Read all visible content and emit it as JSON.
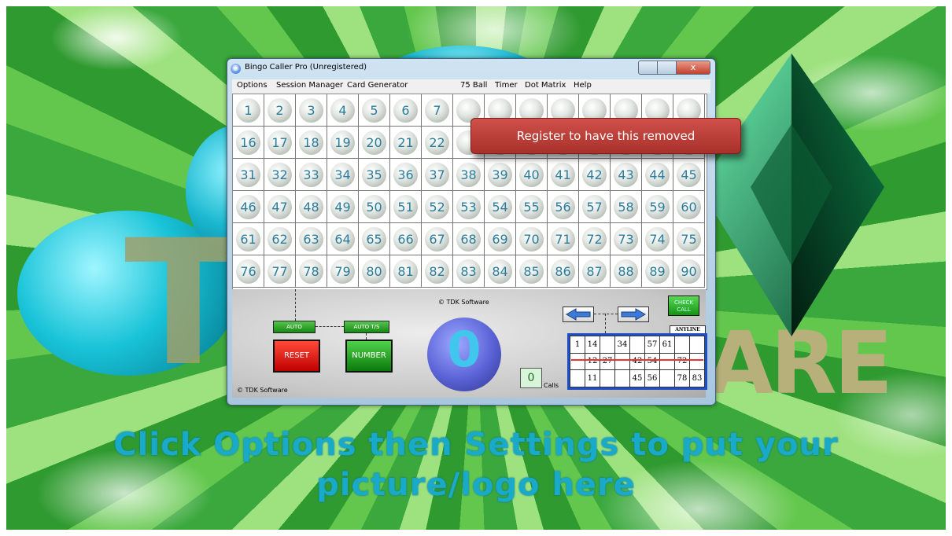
{
  "window": {
    "title": "Bingo Caller Pro (Unregistered)",
    "close_label": "x"
  },
  "menu": [
    "Options",
    "Session Manager",
    "Card Generator",
    "75 Ball",
    "Timer",
    "Dot Matrix",
    "Help"
  ],
  "grid": {
    "rows": [
      [
        "1",
        "2",
        "3",
        "4",
        "5",
        "6",
        "7",
        "",
        "",
        "",
        "",
        "",
        "",
        "",
        ""
      ],
      [
        "16",
        "17",
        "18",
        "19",
        "20",
        "21",
        "22",
        "",
        "",
        "",
        "",
        "",
        "",
        "",
        ""
      ],
      [
        "31",
        "32",
        "33",
        "34",
        "35",
        "36",
        "37",
        "38",
        "39",
        "40",
        "41",
        "42",
        "43",
        "44",
        "45"
      ],
      [
        "46",
        "47",
        "48",
        "49",
        "50",
        "51",
        "52",
        "53",
        "54",
        "55",
        "56",
        "57",
        "58",
        "59",
        "60"
      ],
      [
        "61",
        "62",
        "63",
        "64",
        "65",
        "66",
        "67",
        "68",
        "69",
        "70",
        "71",
        "72",
        "73",
        "74",
        "75"
      ],
      [
        "76",
        "77",
        "78",
        "79",
        "80",
        "81",
        "82",
        "83",
        "84",
        "85",
        "86",
        "87",
        "88",
        "89",
        "90"
      ]
    ]
  },
  "controls": {
    "auto": "AUTO",
    "auto_ts": "AUTO T/S",
    "reset": "RESET",
    "number": "NUMBER",
    "current_number": "0",
    "copyright_top": "© TDK Software",
    "copyright_bottom": "© TDK Software",
    "calls_count": "0",
    "calls_label": "Calls",
    "check_call": "CHECK CALL",
    "anyline": "ANYLINE"
  },
  "card": {
    "rows": [
      [
        "1",
        "14",
        "",
        "34",
        "",
        "57",
        "61",
        "",
        ""
      ],
      [
        "",
        "12",
        "27",
        "",
        "42",
        "54",
        "",
        "72",
        ""
      ],
      [
        "",
        "11",
        "",
        "",
        "45",
        "56",
        "",
        "78",
        "83"
      ]
    ]
  },
  "tooltip": "Register to have this removed",
  "background": {
    "line1": "Click Options then Settings to put your",
    "line2": "picture/logo here",
    "letter_t": "T",
    "letters_are": "ARE"
  },
  "colors": {
    "accent": "#1f4fc6",
    "tooltip": "#b83a33",
    "green_button": "#168a14",
    "red_button": "#c00000"
  }
}
